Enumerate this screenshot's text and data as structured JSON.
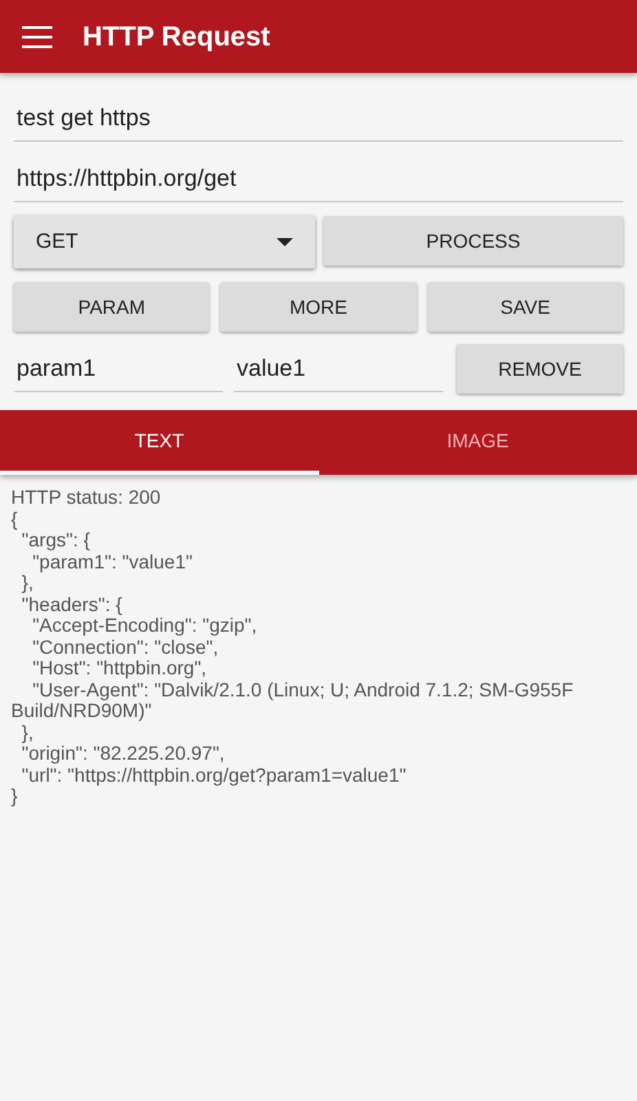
{
  "app_bar": {
    "title": "HTTP Request"
  },
  "name_field": {
    "value": "test get https"
  },
  "url_field": {
    "value": "https://httpbin.org/get"
  },
  "method_dropdown": {
    "value": "GET"
  },
  "buttons": [
    "PROCESS",
    "PARAM",
    "MORE",
    "SAVE"
  ],
  "params": [
    {
      "key": "param1",
      "value": "value1",
      "button": "REMOVE"
    }
  ],
  "tabs": [
    {
      "label": "TEXT",
      "selected": true
    },
    {
      "label": "IMAGE",
      "selected": false
    }
  ],
  "response_lines": [
    "HTTP status: 200",
    "{",
    "  \"args\": {",
    "    \"param1\": \"value1\"",
    "  },",
    "  \"headers\": {",
    "    \"Accept-Encoding\": \"gzip\",",
    "    \"Connection\": \"close\",",
    "    \"Host\": \"httpbin.org\",",
    "    \"User-Agent\": \"Dalvik/2.1.0 (Linux; U; Android 7.1.2; SM-G955F Build/NRD90M)\"",
    "  },",
    "  \"origin\": \"82.225.20.97\",",
    "  \"url\": \"https://httpbin.org/get?param1=value1\"",
    "}"
  ]
}
